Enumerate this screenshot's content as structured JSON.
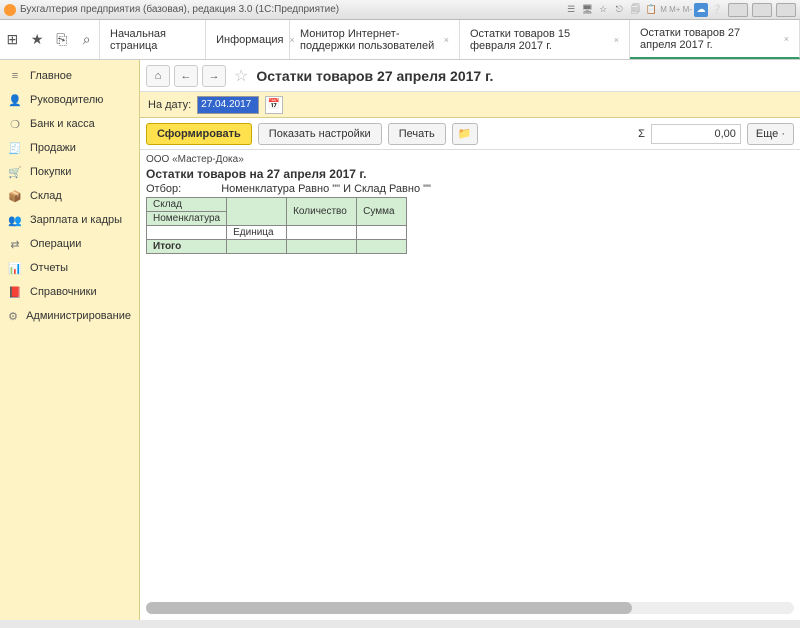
{
  "titlebar": {
    "title": "Бухгалтерия предприятия (базовая), редакция 3.0  (1С:Предприятие)"
  },
  "quick": {
    "apps": "⊞",
    "star": "★",
    "clip": "⎘",
    "search": "⌕"
  },
  "tabs": [
    {
      "label": "Начальная страница",
      "closable": false
    },
    {
      "label": "Информация",
      "closable": true
    },
    {
      "label": "Монитор Интернет-поддержки пользователей",
      "closable": true
    },
    {
      "label": "Остатки товаров 15 февраля 2017 г.",
      "closable": true
    },
    {
      "label": "Остатки товаров 27 апреля 2017 г.",
      "closable": true,
      "active": true
    }
  ],
  "sidebar": [
    {
      "icon": "≡",
      "label": "Главное"
    },
    {
      "icon": "👤",
      "label": "Руководителю"
    },
    {
      "icon": "❍",
      "label": "Банк и касса"
    },
    {
      "icon": "🧾",
      "label": "Продажи"
    },
    {
      "icon": "🛒",
      "label": "Покупки"
    },
    {
      "icon": "📦",
      "label": "Склад"
    },
    {
      "icon": "👥",
      "label": "Зарплата и кадры"
    },
    {
      "icon": "⇄",
      "label": "Операции"
    },
    {
      "icon": "📊",
      "label": "Отчеты"
    },
    {
      "icon": "📕",
      "label": "Справочники"
    },
    {
      "icon": "⚙",
      "label": "Администрирование"
    }
  ],
  "nav": {
    "home": "⌂",
    "back": "←",
    "fwd": "→"
  },
  "page_title": "Остатки товаров 27 апреля 2017 г.",
  "date": {
    "label": "На дату:",
    "value": "27.04.2017"
  },
  "toolbar": {
    "generate": "Сформировать",
    "settings": "Показать настройки",
    "print": "Печать",
    "sigma": "Σ",
    "sum": "0,00",
    "more": "Еще ·"
  },
  "report": {
    "org": "ООО «Мастер-Дока»",
    "title": "Остатки товаров на 27 апреля 2017 г.",
    "filter_label": "Отбор:",
    "filter_text": "Номенклатура Равно \"\" И Склад Равно \"\"",
    "headers": {
      "h1": "Склад",
      "h2": "Количество",
      "h3": "Сумма",
      "h4": "Номенклатура",
      "h5": "Единица"
    },
    "total": "Итого"
  }
}
